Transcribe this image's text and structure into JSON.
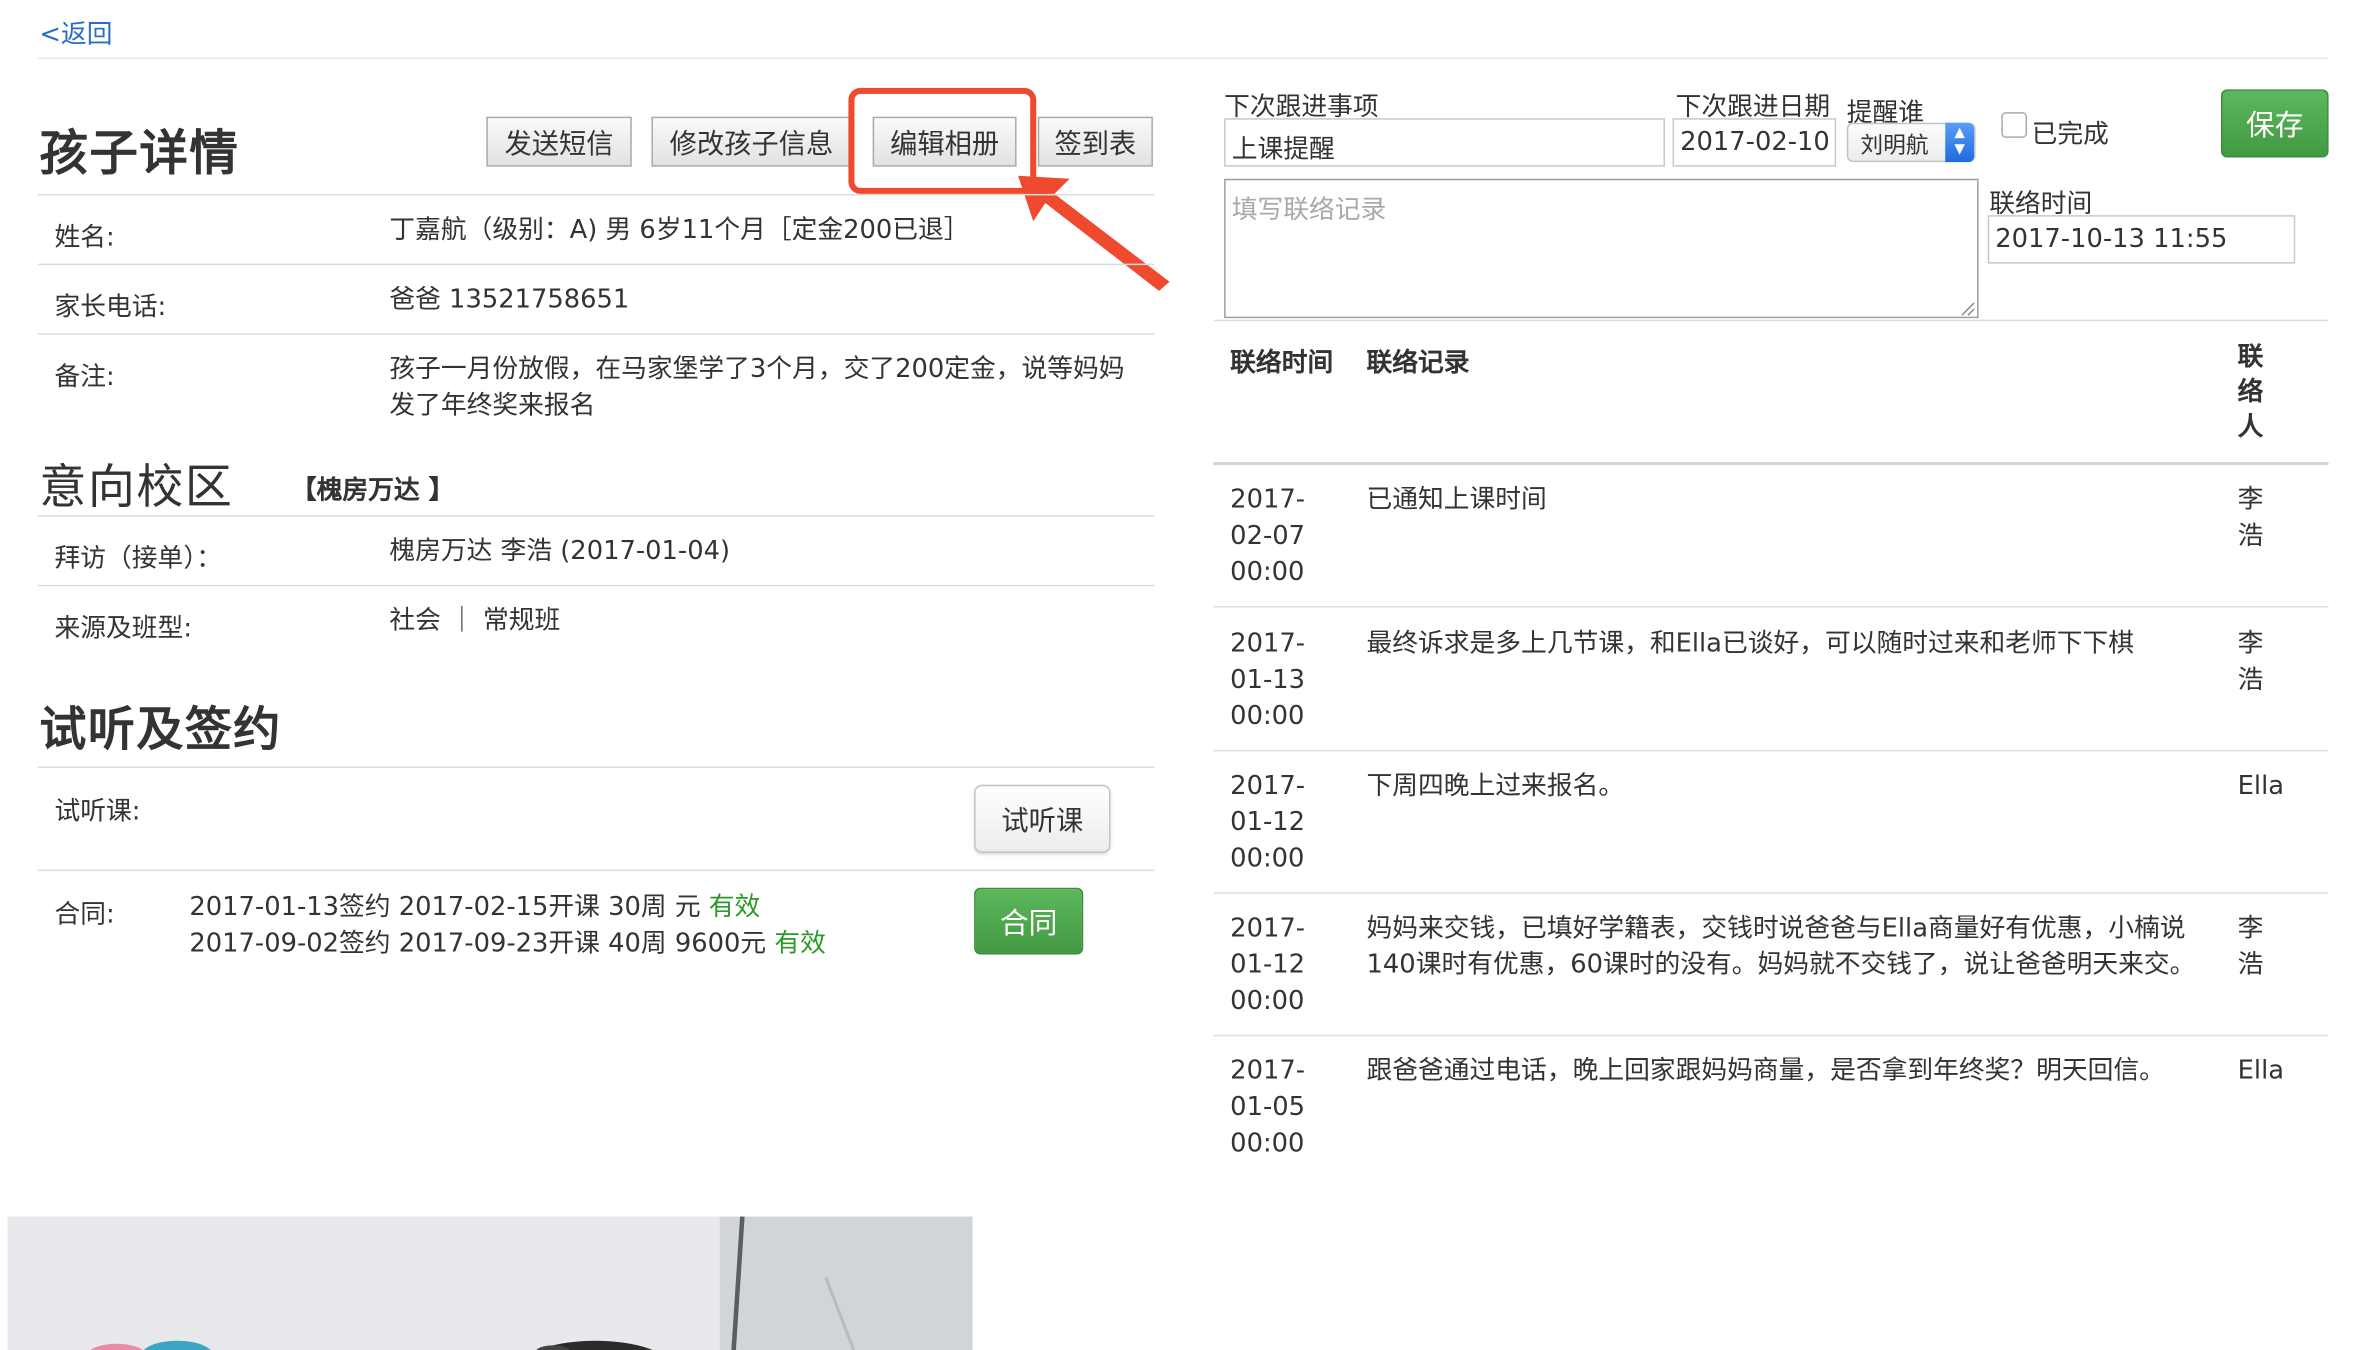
{
  "nav": {
    "back_label": "<返回"
  },
  "child_detail": {
    "title": "孩子详情",
    "buttons": {
      "send_sms": "发送短信",
      "edit_child": "修改孩子信息",
      "edit_album": "编辑相册",
      "sign_in_sheet": "签到表"
    },
    "fields": [
      {
        "label": "姓名:",
        "value": "丁嘉航（级别：A) 男 6岁11个月［定金200已退］"
      },
      {
        "label": "家长电话:",
        "value": "爸爸 13521758651"
      },
      {
        "label": "备注:",
        "value_line1": "孩子一月份放假，在马家堡学了3个月，交了200定金，说等妈妈",
        "value_line2": "发了年终奖来报名"
      }
    ]
  },
  "campus": {
    "title": "意向校区",
    "name": "【槐房万达 】",
    "fields": [
      {
        "label": "拜访（接单）：",
        "value": "槐房万达  李浩 (2017-01-04)"
      },
      {
        "label": "来源及班型:",
        "value": "社会 ｜ 常规班"
      }
    ]
  },
  "trial": {
    "title": "试听及签约",
    "trial_label": "试听课:",
    "trial_button": "试听课",
    "contract_label": "合同:",
    "contracts": [
      {
        "text": "2017-01-13签约 2017-02-15开课 30周 元",
        "status": "有效"
      },
      {
        "text": "2017-09-02签约 2017-09-23开课 40周 9600元",
        "status": "有效"
      }
    ],
    "contract_button": "合同"
  },
  "followup": {
    "next_item_label": "下次跟进事项",
    "next_item_value": "上课提醒",
    "next_date_label": "下次跟进日期",
    "next_date_value": "2017-02-10",
    "remind_label": "提醒谁",
    "remind_value": "刘明航",
    "completed_label": "已完成",
    "save_label": "保存",
    "record_placeholder": "填写联络记录",
    "contact_time_label": "联络时间",
    "contact_time_value": "2017-10-13 11:55"
  },
  "records": {
    "headers": {
      "time": "联络时间",
      "record": "联络记录",
      "contact_l1": "联",
      "contact_l2": "络",
      "contact_l3": "人"
    },
    "rows": [
      {
        "date_l1": "2017-",
        "date_l2": "02-07",
        "date_l3": "00:00",
        "record_l1": "已通知上课时间",
        "record_l2": "",
        "person_l1": "李",
        "person_l2": "浩"
      },
      {
        "date_l1": "2017-",
        "date_l2": "01-13",
        "date_l3": "00:00",
        "record_l1": "最终诉求是多上几节课，和Ella已谈好，可以随时过来和老师下下棋",
        "record_l2": "",
        "person_l1": "李",
        "person_l2": "浩"
      },
      {
        "date_l1": "2017-",
        "date_l2": "01-12",
        "date_l3": "00:00",
        "record_l1": "下周四晚上过来报名。",
        "record_l2": "",
        "person_l1": "Ella",
        "person_l2": ""
      },
      {
        "date_l1": "2017-",
        "date_l2": "01-12",
        "date_l3": "00:00",
        "record_l1": "妈妈来交钱，已填好学籍表，交钱时说爸爸与Ella商量好有优惠，小楠说",
        "record_l2": "140课时有优惠，60课时的没有。妈妈就不交钱了，说让爸爸明天来交。",
        "person_l1": "李",
        "person_l2": "浩"
      },
      {
        "date_l1": "2017-",
        "date_l2": "01-05",
        "date_l3": "00:00",
        "record_l1": "跟爸爸通过电话，晚上回家跟妈妈商量，是否拿到年终奖？明天回信。",
        "record_l2": "",
        "person_l1": "Ella",
        "person_l2": ""
      }
    ]
  },
  "colors": {
    "highlight": "#ef4a2f",
    "link": "#2a6cc9",
    "valid_status": "#2a9a2a",
    "save_button": "#5cb85c"
  },
  "icons": {
    "annotation_arrow": "arrow-icon",
    "select_arrows": "updown-chevron-icon",
    "photo": "child-photo"
  }
}
